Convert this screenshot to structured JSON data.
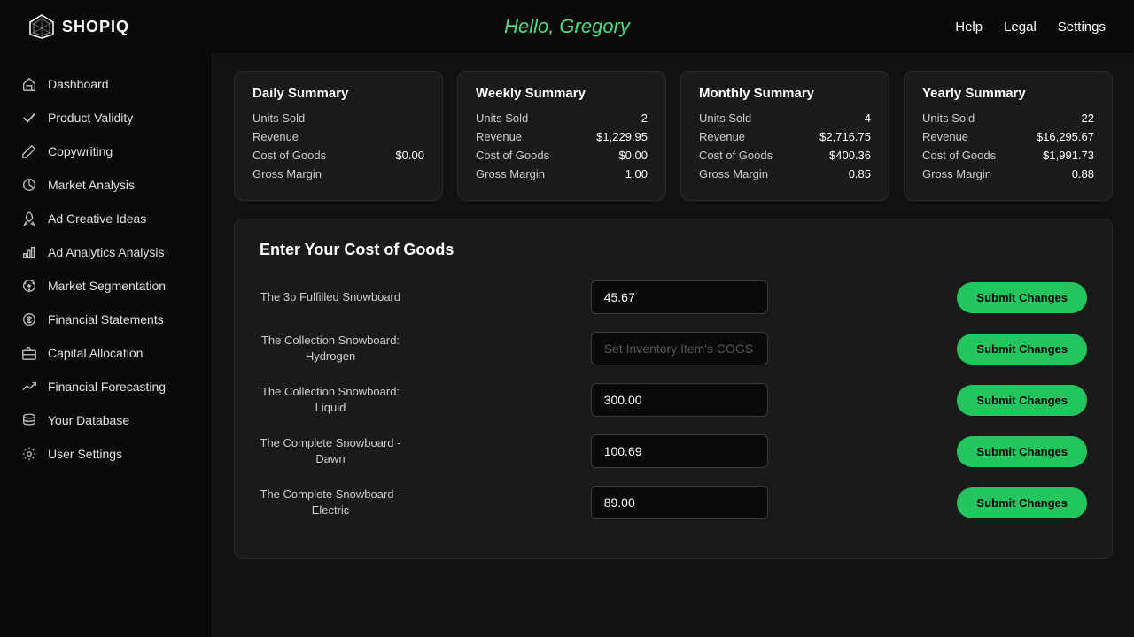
{
  "header": {
    "logo_text": "SHOPIQ",
    "greeting": "Hello, Gregory",
    "nav": [
      {
        "label": "Help"
      },
      {
        "label": "Legal"
      },
      {
        "label": "Settings"
      }
    ]
  },
  "sidebar": {
    "items": [
      {
        "label": "Dashboard",
        "icon": "home"
      },
      {
        "label": "Product Validity",
        "icon": "check"
      },
      {
        "label": "Copywriting",
        "icon": "pencil"
      },
      {
        "label": "Market Analysis",
        "icon": "chart-pie"
      },
      {
        "label": "Ad Creative Ideas",
        "icon": "rocket"
      },
      {
        "label": "Ad Analytics Analysis",
        "icon": "bar-chart"
      },
      {
        "label": "Market Segmentation",
        "icon": "circle-dots"
      },
      {
        "label": "Financial Statements",
        "icon": "dollar"
      },
      {
        "label": "Capital Allocation",
        "icon": "briefcase"
      },
      {
        "label": "Financial Forecasting",
        "icon": "trending-up"
      },
      {
        "label": "Your Database",
        "icon": "database"
      },
      {
        "label": "User Settings",
        "icon": "gear"
      }
    ]
  },
  "summary_cards": [
    {
      "title": "Daily Summary",
      "units_sold_label": "Units Sold",
      "units_sold_value": "",
      "revenue_label": "Revenue",
      "revenue_value": "",
      "cogs_label": "Cost of Goods",
      "cogs_value": "$0.00",
      "margin_label": "Gross Margin",
      "margin_value": ""
    },
    {
      "title": "Weekly Summary",
      "units_sold_label": "Units Sold",
      "units_sold_value": "2",
      "revenue_label": "Revenue",
      "revenue_value": "$1,229.95",
      "cogs_label": "Cost of Goods",
      "cogs_value": "$0.00",
      "margin_label": "Gross Margin",
      "margin_value": "1.00"
    },
    {
      "title": "Monthly Summary",
      "units_sold_label": "Units Sold",
      "units_sold_value": "4",
      "revenue_label": "Revenue",
      "revenue_value": "$2,716.75",
      "cogs_label": "Cost of Goods",
      "cogs_value": "$400.36",
      "margin_label": "Gross Margin",
      "margin_value": "0.85"
    },
    {
      "title": "Yearly Summary",
      "units_sold_label": "Units Sold",
      "units_sold_value": "22",
      "revenue_label": "Revenue",
      "revenue_value": "$16,295.67",
      "cogs_label": "Cost of Goods",
      "cogs_value": "$1,991.73",
      "margin_label": "Gross Margin",
      "margin_value": "0.88"
    }
  ],
  "cogs_section": {
    "title": "Enter Your Cost of Goods",
    "products": [
      {
        "name": "The 3p Fulfilled Snowboard",
        "value": "45.67",
        "placeholder": "",
        "button_label": "Submit Changes"
      },
      {
        "name": "The Collection Snowboard: Hydrogen",
        "value": "",
        "placeholder": "Set Inventory Item's COGS",
        "button_label": "Submit Changes"
      },
      {
        "name": "The Collection Snowboard: Liquid",
        "value": "300.00",
        "placeholder": "",
        "button_label": "Submit Changes"
      },
      {
        "name": "The Complete Snowboard - Dawn",
        "value": "100.69",
        "placeholder": "",
        "button_label": "Submit Changes"
      },
      {
        "name": "The Complete Snowboard - Electric",
        "value": "89.00",
        "placeholder": "",
        "button_label": "Submit Changes"
      }
    ]
  }
}
